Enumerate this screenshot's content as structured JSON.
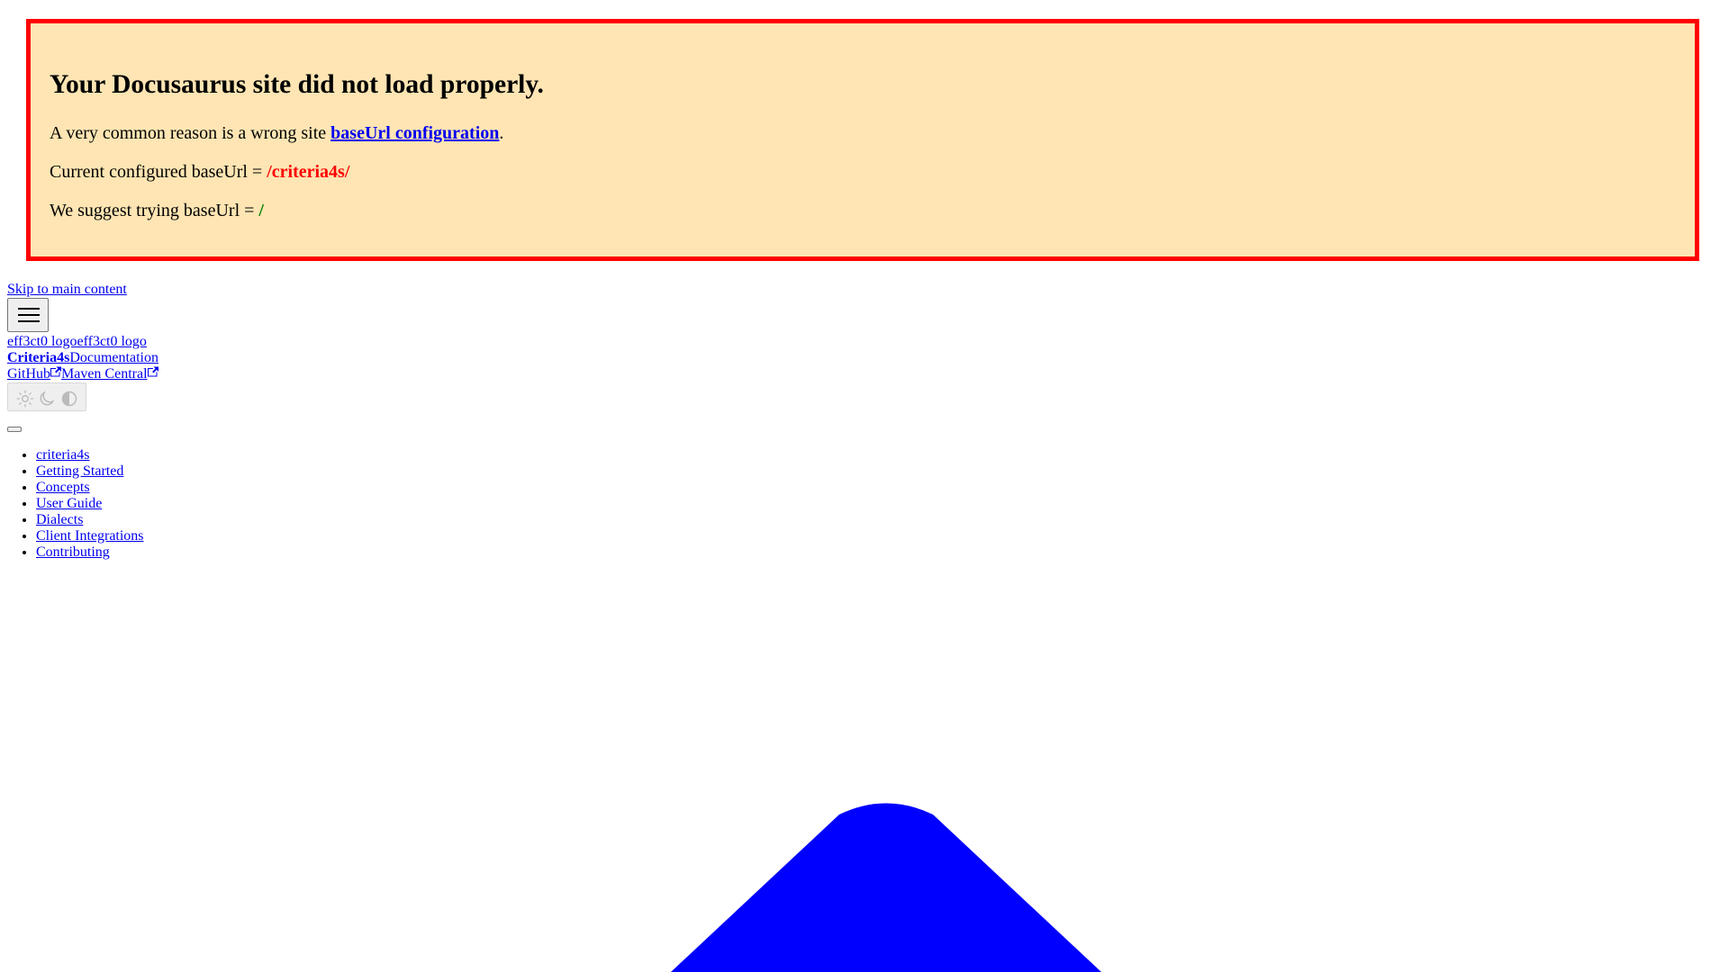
{
  "banner": {
    "title": "Your Docusaurus site did not load properly.",
    "reason_prefix": "A very common reason is a wrong site ",
    "reason_link": "baseUrl configuration",
    "reason_suffix": ".",
    "current_prefix": "Current configured baseUrl = ",
    "current_value": "/criteria4s/",
    "suggest_prefix": "We suggest trying baseUrl = ",
    "suggest_value": "/"
  },
  "skip_link": "Skip to main content",
  "navbar": {
    "logo_alt_1": "eff3ct0 logo",
    "logo_alt_2": "eff3ct0 logo",
    "brand": "Criteria4s",
    "docs_link": "Documentation",
    "github_link": "GitHub",
    "maven_link": "Maven Central"
  },
  "sidebar": {
    "items": [
      {
        "label": "criteria4s"
      },
      {
        "label": "Getting Started"
      },
      {
        "label": "Concepts"
      },
      {
        "label": "User Guide"
      },
      {
        "label": "Dialects"
      },
      {
        "label": "Client Integrations"
      },
      {
        "label": "Contributing"
      }
    ]
  },
  "colors": {
    "banner_bg": "#fee5b3",
    "banner_border": "#ff0000",
    "link": "#0000ee",
    "bad_value": "#ff0000",
    "good_value": "#008000",
    "shape_fill": "#0000ff"
  },
  "icons": {
    "menu": "hamburger-icon",
    "external": "external-link-icon",
    "theme_light": "sun-icon",
    "theme_dark": "moon-icon",
    "theme_system": "half-circle-icon"
  }
}
